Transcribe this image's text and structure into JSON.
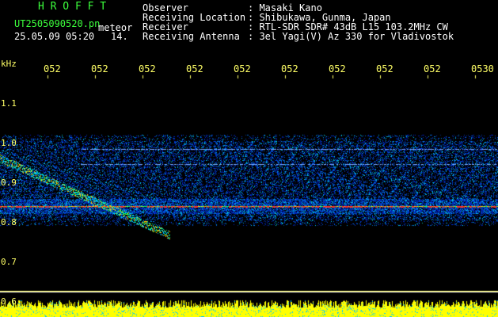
{
  "header": {
    "app_name": "H R O F F T",
    "filename": "UT2505090520.pn",
    "filename_suffix": "meteor",
    "datetime": "25.05.09 05:20",
    "number": "14.",
    "fields": [
      {
        "label": "Observer",
        "value": ": Masaki Kano"
      },
      {
        "label": "Receiving Location",
        "value": ": Shibukawa, Gunma, Japan"
      },
      {
        "label": "Receiver",
        "value": ": RTL-SDR SDR# 43dB L15 103.2MHz CW"
      },
      {
        "label": "Receiving Antenna",
        "value": ": 3el Yagi(V) Az 330 for Vladivostok"
      }
    ]
  },
  "axis": {
    "unit": "kHz",
    "y_ticks": [
      "1.1",
      "1.0",
      "0.9",
      "0.8",
      "0.7",
      "0.6"
    ],
    "x_ticks": [
      "052",
      "052",
      "052",
      "052",
      "052",
      "052",
      "052",
      "052",
      "052",
      "0530"
    ]
  },
  "colors": {
    "green": "#3cff3c",
    "white": "#ffffff",
    "yellow": "#ffff66",
    "background": "#000000"
  }
}
